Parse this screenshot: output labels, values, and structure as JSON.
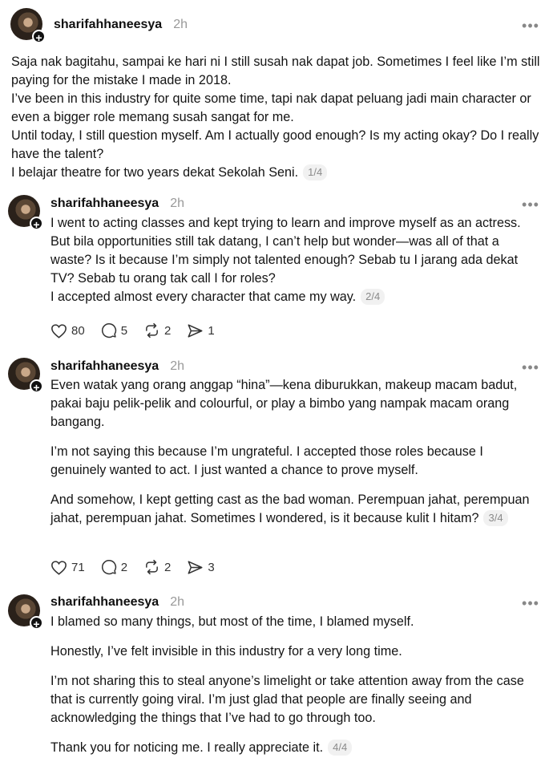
{
  "posts": [
    {
      "username": "sharifahhaneesya",
      "time": "2h",
      "more": "•••",
      "paragraphs": [
        "Saja nak bagitahu, sampai ke hari ni I still susah nak dapat job. Sometimes I feel like I’m still paying for the mistake I made in 2018.",
        "I’ve been in this industry for quite some time, tapi nak dapat peluang jadi main character or even a bigger role memang susah sangat for me.",
        "Until today, I still question myself. Am I actually good enough? Is my acting okay? Do I really have the talent?",
        "I belajar theatre for two years dekat Sekolah Seni."
      ],
      "badge": "1/4"
    },
    {
      "username": "sharifahhaneesya",
      "time": "2h",
      "more": "•••",
      "paragraphs": [
        "I went to acting classes and kept trying to learn and improve myself as an actress. But bila opportunities still tak datang, I can’t help but wonder—was all of that a waste? Is it because I’m simply not talented enough? Sebab tu I jarang ada dekat TV? Sebab tu orang tak call I for roles?",
        "I accepted almost every character that came my way."
      ],
      "badge": "2/4",
      "likes": "80",
      "replies": "5",
      "reposts": "2",
      "shares": "1"
    },
    {
      "username": "sharifahhaneesya",
      "time": "2h",
      "more": "•••",
      "paragraphs": [
        "Even watak yang orang anggap “hina”—kena diburukkan, makeup macam badut, pakai baju pelik-pelik and colourful, or play a bimbo yang nampak macam orang bangang.",
        "I’m not saying this because I’m ungrateful. I accepted those roles because I genuinely wanted to act. I just wanted a chance to prove myself.",
        "And somehow, I kept getting cast as the bad woman. Perempuan jahat, perempuan jahat, perempuan jahat. Sometimes I wondered, is it because kulit I hitam?"
      ],
      "badge": "3/4",
      "likes": "71",
      "replies": "2",
      "reposts": "2",
      "shares": "3"
    },
    {
      "username": "sharifahhaneesya",
      "time": "2h",
      "more": "•••",
      "paragraphs": [
        "I blamed so many things, but most of the time, I blamed myself.",
        "Honestly, I’ve felt invisible in this industry for a very long time.",
        "I’m not sharing this to steal anyone’s limelight or take attention away from the case that is currently going viral. I’m just glad that people are finally seeing and acknowledging the things that I’ve had to go through too.",
        "Thank you for noticing me. I really appreciate it."
      ],
      "badge": "4/4"
    }
  ],
  "icons": {
    "like": "heart-icon",
    "reply": "comment-icon",
    "repost": "repost-icon",
    "share": "send-icon",
    "follow": "plus-icon",
    "more": "more-icon"
  }
}
